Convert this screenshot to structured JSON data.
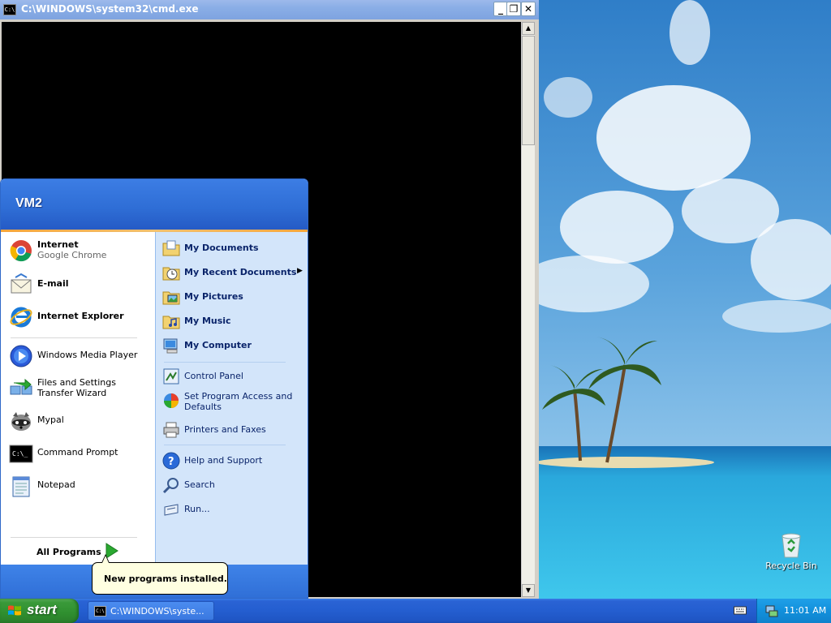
{
  "cmd_window": {
    "title": "C:\\WINDOWS\\system32\\cmd.exe",
    "minimize": "_",
    "restore": "❐",
    "close": "✕"
  },
  "start_menu": {
    "user": "VM2",
    "pinned": [
      {
        "label": "Internet",
        "sublabel": "Google Chrome",
        "icon": "chrome-icon"
      },
      {
        "label": "E-mail",
        "icon": "email-icon"
      }
    ],
    "recent": [
      {
        "label": "Internet Explorer",
        "icon": "internet-explorer-icon"
      },
      {
        "label": "Windows Media Player",
        "icon": "media-player-icon"
      },
      {
        "label": "Files and Settings Transfer Wizard",
        "icon": "transfer-wizard-icon"
      },
      {
        "label": "Mypal",
        "icon": "mypal-icon"
      },
      {
        "label": "Command Prompt",
        "icon": "command-prompt-icon"
      },
      {
        "label": "Notepad",
        "icon": "notepad-icon"
      }
    ],
    "all_programs": "All Programs",
    "places": [
      {
        "label": "My Documents",
        "icon": "my-documents-icon"
      },
      {
        "label": "My Recent Documents",
        "icon": "recent-documents-icon",
        "submenu": true
      },
      {
        "label": "My Pictures",
        "icon": "my-pictures-icon"
      },
      {
        "label": "My Music",
        "icon": "my-music-icon"
      },
      {
        "label": "My Computer",
        "icon": "my-computer-icon"
      }
    ],
    "settings": [
      {
        "label": "Control Panel",
        "icon": "control-panel-icon"
      },
      {
        "label": "Set Program Access and Defaults",
        "icon": "program-access-icon"
      },
      {
        "label": "Printers and Faxes",
        "icon": "printer-icon"
      }
    ],
    "help": [
      {
        "label": "Help and Support",
        "icon": "help-icon"
      },
      {
        "label": "Search",
        "icon": "search-icon"
      },
      {
        "label": "Run...",
        "icon": "run-icon"
      }
    ]
  },
  "balloon": {
    "text": "New programs installed."
  },
  "desktop": {
    "recycle_bin": "Recycle Bin"
  },
  "taskbar": {
    "start_label": "start",
    "task_button": "C:\\WINDOWS\\syste...",
    "clock": "11:01 AM"
  },
  "colors": {
    "taskbar_blue": "#245ed0",
    "start_green": "#2f8f2f",
    "menu_header_blue": "#2f6ed6",
    "places_panel": "#d3e5fa",
    "balloon_bg": "#ffffe1"
  }
}
